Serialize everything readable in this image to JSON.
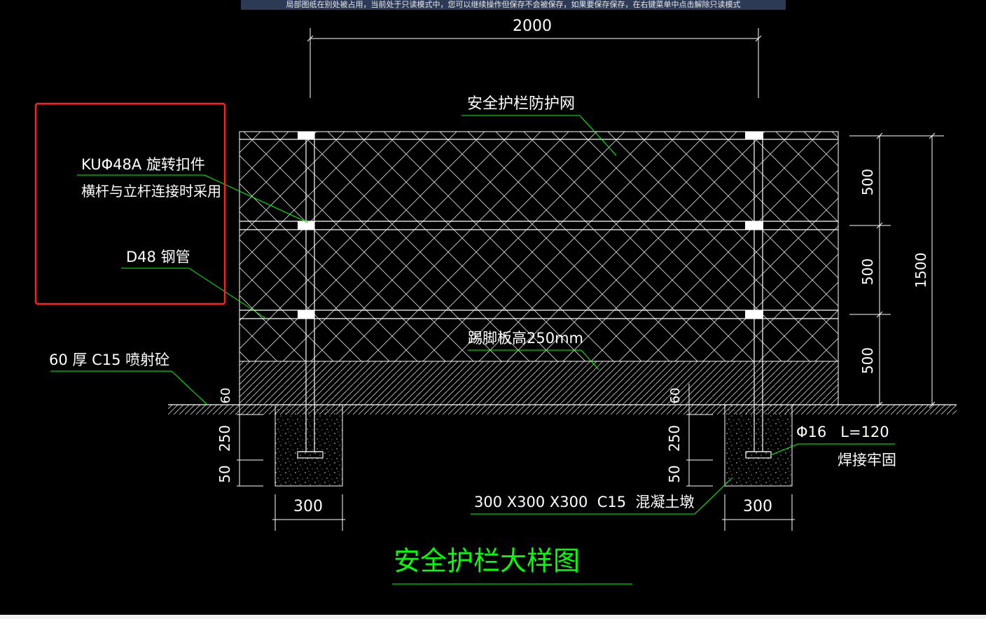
{
  "banner": {
    "text": "局部图纸在别处被占用，当前处于只读模式中，您可以继续操作但保存不会被保存，如果要保存保存，在右键菜单中点击解除只读模式"
  },
  "colors": {
    "background": "#000000",
    "line": "#ffffff",
    "leader": "#00ff00",
    "title": "#00ff00",
    "highlight": "#ff2020"
  },
  "dims": {
    "width_top": "2000",
    "seg1": "500",
    "seg2": "500",
    "seg3": "500",
    "total": "1500",
    "left_60": "60",
    "left_250": "250",
    "left_50": "50",
    "right_60": "60",
    "right_250": "250",
    "right_50": "50",
    "left_300": "300",
    "right_300": "300"
  },
  "labels": {
    "net": "安全护栏防护网",
    "fitting_line1": "KUΦ48A 旋转扣件",
    "fitting_line2": "横杆与立杆连接时采用",
    "pipe": "D48 钢管",
    "toeboard": "踢脚板高250mm",
    "shotcrete": "60 厚 C15 喷射砼",
    "rebar_line1": "Φ16   L=120",
    "rebar_line2": "焊接牢固",
    "pier": "300 X300 X300  C15  混凝土墩"
  },
  "title": "安全护栏大样图"
}
